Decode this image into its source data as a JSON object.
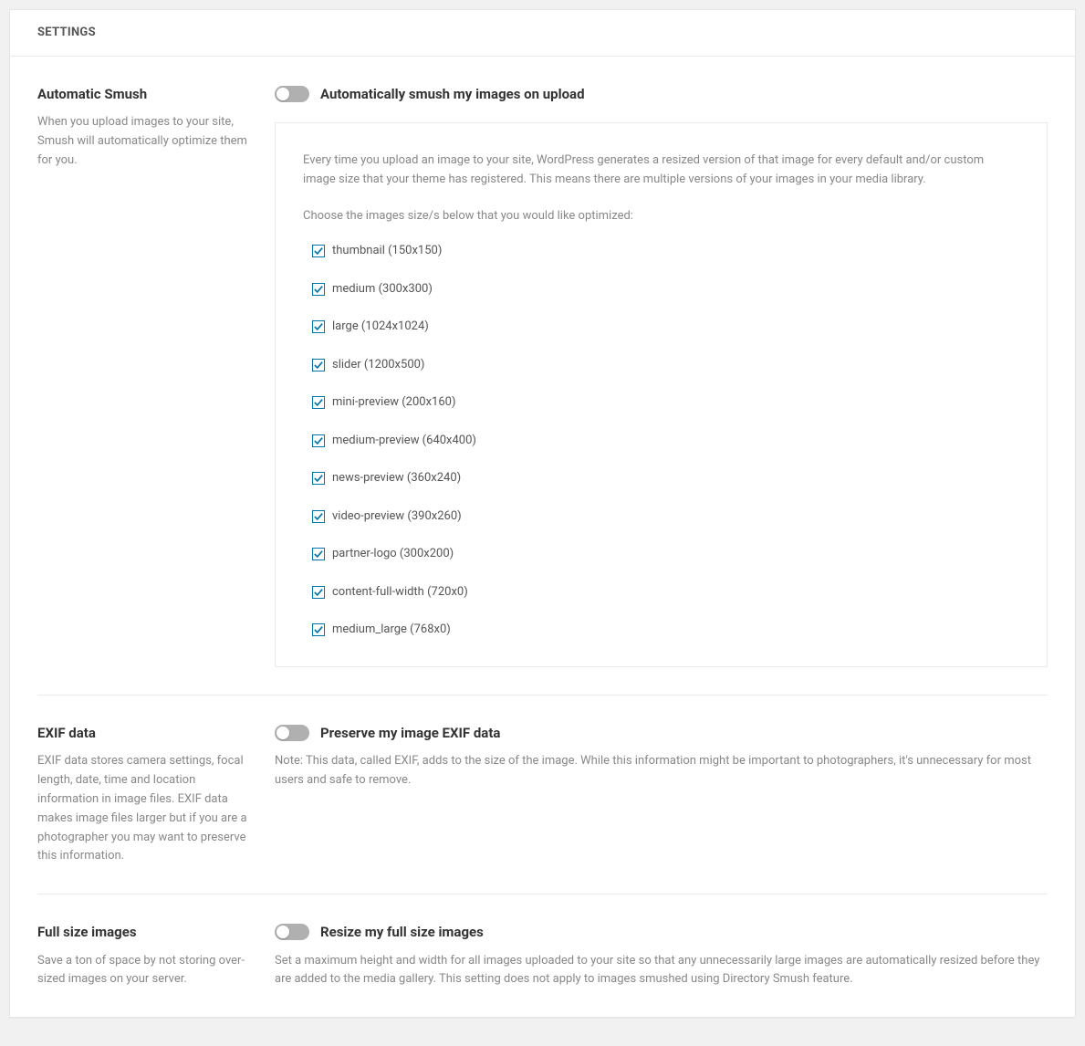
{
  "header": {
    "title": "SETTINGS"
  },
  "sections": {
    "auto": {
      "title": "Automatic Smush",
      "desc": "When you upload images to your site, Smush will automatically optimize them for you.",
      "toggle_label": "Automatically smush my images on upload",
      "box_intro": "Every time you upload an image to your site, WordPress generates a resized version of that image for every default and/or custom image size that your theme has registered. This means there are multiple versions of your images in your media library.",
      "box_choose": "Choose the images size/s below that you would like optimized:",
      "sizes": [
        {
          "label": "thumbnail (150x150)",
          "checked": true
        },
        {
          "label": "medium (300x300)",
          "checked": true
        },
        {
          "label": "large (1024x1024)",
          "checked": true
        },
        {
          "label": "slider (1200x500)",
          "checked": true
        },
        {
          "label": "mini-preview (200x160)",
          "checked": true
        },
        {
          "label": "medium-preview (640x400)",
          "checked": true
        },
        {
          "label": "news-preview (360x240)",
          "checked": true
        },
        {
          "label": "video-preview (390x260)",
          "checked": true
        },
        {
          "label": "partner-logo (300x200)",
          "checked": true
        },
        {
          "label": "content-full-width (720x0)",
          "checked": true
        },
        {
          "label": "medium_large (768x0)",
          "checked": true
        }
      ]
    },
    "exif": {
      "title": "EXIF data",
      "desc": "EXIF data stores camera settings, focal length, date, time and location information in image files. EXIF data makes image files larger but if you are a photographer you may want to preserve this information.",
      "toggle_label": "Preserve my image EXIF data",
      "note": "Note: This data, called EXIF, adds to the size of the image. While this information might be important to photographers, it's unnecessary for most users and safe to remove."
    },
    "fullsize": {
      "title": "Full size images",
      "desc": "Save a ton of space by not storing over-sized images on your server.",
      "toggle_label": "Resize my full size images",
      "note": "Set a maximum height and width for all images uploaded to your site so that any unnecessarily large images are automatically resized before they are added to the media gallery. This setting does not apply to images smushed using Directory Smush feature."
    }
  }
}
